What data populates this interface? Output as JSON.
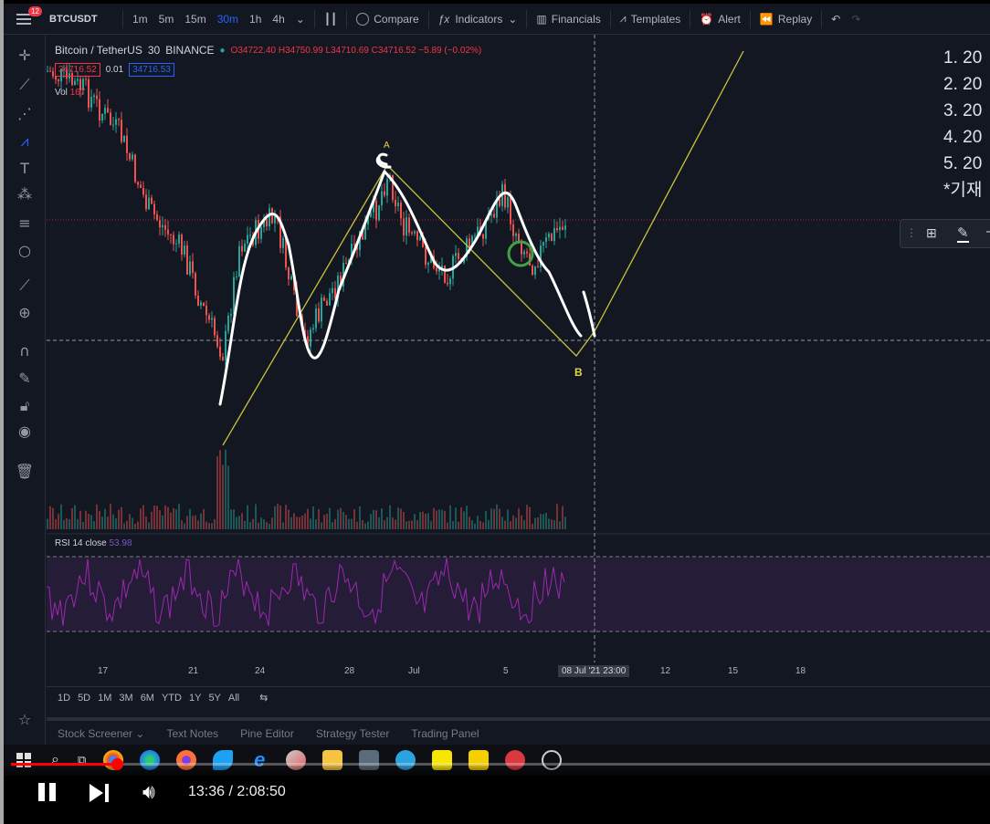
{
  "toolbar": {
    "notification_count": "12",
    "symbol": "BTCUSDT",
    "intervals": [
      "1m",
      "5m",
      "15m",
      "30m",
      "1h",
      "4h"
    ],
    "active_interval": "30m",
    "compare": "Compare",
    "indicators": "Indicators",
    "financials": "Financials",
    "templates": "Templates",
    "alert": "Alert",
    "replay": "Replay"
  },
  "legend": {
    "title": "Bitcoin / TetherUS",
    "interval": "30",
    "exchange": "BINANCE",
    "ohlc": "O34722.40 H34750.99 L34710.69 C34716.52 −5.89 (−0.02%)",
    "bid": "34716.52",
    "spread": "0.01",
    "ask": "34716.53",
    "vol_label": "Vol",
    "vol_value": "167",
    "rsi_label": "RSI 14 close",
    "rsi_value": "53.98"
  },
  "annotations": {
    "a_label": "A",
    "b_label": "B"
  },
  "notes": [
    "1. 20",
    "2. 20",
    "3. 20",
    "4. 20",
    "5. 20",
    "*기재"
  ],
  "time_axis": {
    "labels": [
      "17",
      "21",
      "24",
      "28",
      "Jul",
      "5",
      "12",
      "15",
      "18"
    ],
    "cursor": "08 Jul '21   23:00"
  },
  "range_bar": [
    "1D",
    "5D",
    "1M",
    "3M",
    "6M",
    "YTD",
    "1Y",
    "5Y",
    "All"
  ],
  "bottom_tabs": [
    "Stock Screener",
    "Text Notes",
    "Pine Editor",
    "Strategy Tester",
    "Trading Panel"
  ],
  "player": {
    "time": "13:36 / 2:08:50",
    "progress": 0.108
  },
  "colors": {
    "background": "#131722",
    "candle_up": "#26a69a",
    "candle_down": "#ef5350",
    "fib_line": "#c9c23a",
    "rsi_line": "#9c27b0",
    "rsi_band": "#2a1f3d"
  }
}
